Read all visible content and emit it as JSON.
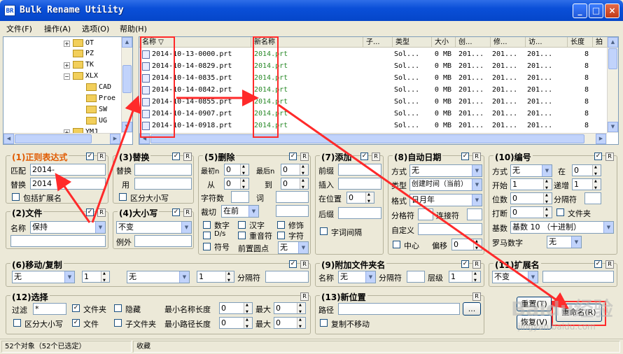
{
  "window": {
    "title": "Bulk Rename Utility",
    "icon_text": "BR",
    "minimize": "_",
    "maximize": "□",
    "close": "×"
  },
  "menu": [
    "文件(F)",
    "操作(A)",
    "选项(O)",
    "帮助(H)"
  ],
  "tree": [
    {
      "label": "OT",
      "expander": "+"
    },
    {
      "label": "PZ",
      "expander": ""
    },
    {
      "label": "TK",
      "expander": "+"
    },
    {
      "label": "XLX",
      "expander": "−"
    },
    {
      "label": "CAD",
      "expander": ""
    },
    {
      "label": "Proe",
      "expander": ""
    },
    {
      "label": "SW",
      "expander": ""
    },
    {
      "label": "UG",
      "expander": ""
    },
    {
      "label": "YMJ",
      "expander": "+"
    }
  ],
  "columns": [
    "名称 ▽",
    "新名称",
    "子...",
    "类型",
    "大小",
    "创...",
    "修...",
    "访...",
    "长度",
    "拍"
  ],
  "files": [
    {
      "name": "2014-10-13-0000.prt",
      "new": "2014.prt",
      "type": "Sol...",
      "size": "0 MB",
      "c": "201...",
      "m": "201...",
      "a": "201...",
      "len": "8"
    },
    {
      "name": "2014-10-14-0829.prt",
      "new": "2014.prt",
      "type": "Sol...",
      "size": "0 MB",
      "c": "201...",
      "m": "201...",
      "a": "201...",
      "len": "8"
    },
    {
      "name": "2014-10-14-0835.prt",
      "new": "2014.prt",
      "type": "Sol...",
      "size": "0 MB",
      "c": "201...",
      "m": "201...",
      "a": "201...",
      "len": "8"
    },
    {
      "name": "2014-10-14-0842.prt",
      "new": "2014.prt",
      "type": "Sol...",
      "size": "0 MB",
      "c": "201...",
      "m": "201...",
      "a": "201...",
      "len": "8"
    },
    {
      "name": "2014-10-14-0855.prt",
      "new": "2014.prt",
      "type": "Sol...",
      "size": "0 MB",
      "c": "201...",
      "m": "201...",
      "a": "201...",
      "len": "8"
    },
    {
      "name": "2014-10-14-0907.prt",
      "new": "2014.prt",
      "type": "Sol...",
      "size": "0 MB",
      "c": "201...",
      "m": "201...",
      "a": "201...",
      "len": "8"
    },
    {
      "name": "2014-10-14-0918.prt",
      "new": "2014.prt",
      "type": "Sol...",
      "size": "0 MB",
      "c": "201...",
      "m": "201...",
      "a": "201...",
      "len": "8"
    }
  ],
  "g1": {
    "title": "(1)正则表达式",
    "match_label": "匹配",
    "match_value": "2014-",
    "replace_label": "替换",
    "replace_value": "2014",
    "ext_label": "包括扩展名"
  },
  "g2": {
    "title": "(2)文件",
    "name_label": "名称",
    "name_value": "保持"
  },
  "g3": {
    "title": "(3)替换",
    "replace_label": "替换",
    "with_label": "用",
    "case_label": "区分大小写"
  },
  "g4": {
    "title": "(4)大小写",
    "value": "不变",
    "except_label": "例外"
  },
  "g5": {
    "title": "(5)删除",
    "first_n": "最初n",
    "last_n": "最后n",
    "from": "从",
    "to": "到",
    "chars": "字符数",
    "words": "词",
    "crop": "裁切",
    "crop_value": "在前",
    "digits": "数字",
    "chinese": "汉字",
    "trim": "修饰",
    "ds": "D/s",
    "accents": "重音符",
    "charsym": "字符",
    "symbols": "符号",
    "lead_dots": "前置圆点",
    "lead_value": "无",
    "v1": "0",
    "v2": "0",
    "v3": "0",
    "v4": "0"
  },
  "g7": {
    "title": "(7)添加",
    "prefix": "前缀",
    "insert": "插入",
    "at_pos": "在位置",
    "at_value": "0",
    "suffix": "后缀",
    "word_space": "字词间隔"
  },
  "g8": {
    "title": "(8)自动日期",
    "mode_label": "方式",
    "mode_value": "无",
    "type_label": "类型",
    "type_value": "创建时间（当前）",
    "format_label": "格式",
    "format_value": "日月年",
    "sep_label": "分格符",
    "connect_label": "连接符",
    "custom_label": "自定义",
    "center_label": "中心",
    "offset_label": "偏移",
    "offset_value": "0"
  },
  "g10": {
    "title": "(10)编号",
    "mode_label": "方式",
    "mode_value": "无",
    "at_label": "在",
    "at_value": "0",
    "start_label": "开始",
    "start_value": "1",
    "inc_label": "递增",
    "inc_value": "1",
    "pad_label": "位数",
    "pad_value": "0",
    "sep_label": "分隔符",
    "break_label": "打断",
    "break_value": "0",
    "folder_label": "文件夹",
    "base_label": "基数",
    "base_value": "基数 10 （十进制）",
    "roman_label": "罗马数字",
    "roman_value": "无"
  },
  "g6": {
    "title": "(6)移动/复制",
    "sel1": "无",
    "v1": "1",
    "sel2": "无",
    "v2": "1",
    "sep_label": "分隔符"
  },
  "g9": {
    "title": "(9)附加文件夹名",
    "name_label": "名称",
    "name_value": "无",
    "sep_label": "分隔符",
    "level_label": "层级",
    "level_value": "1"
  },
  "g11": {
    "title": "(11)扩展名",
    "value": "不变"
  },
  "g12": {
    "title": "(12)选择",
    "filter_label": "过滤",
    "filter_value": "*",
    "folders": "文件夹",
    "hidden": "隐藏",
    "min_name": "最小名称长度",
    "min_name_value": "0",
    "max1": "最大",
    "max1_value": "0",
    "case": "区分大小写",
    "files": "文件",
    "subfolders": "子文件夹",
    "min_path": "最小路径长度",
    "min_path_value": "0",
    "max2": "最大",
    "max2_value": "0"
  },
  "g13": {
    "title": "(13)新位置",
    "path_label": "路径",
    "browse": "...",
    "copy_no_move": "复制不移动"
  },
  "buttons": {
    "reset": "重置(T)",
    "rename": "重命名(R)",
    "revert": "恢复(V)"
  },
  "r": "R",
  "check": "✓",
  "status": {
    "count": "52个对象（52个已选定）",
    "fav": "收藏"
  },
  "watermark": {
    "main": "Baidu经验",
    "sub": "jingyan.baidu.com"
  }
}
